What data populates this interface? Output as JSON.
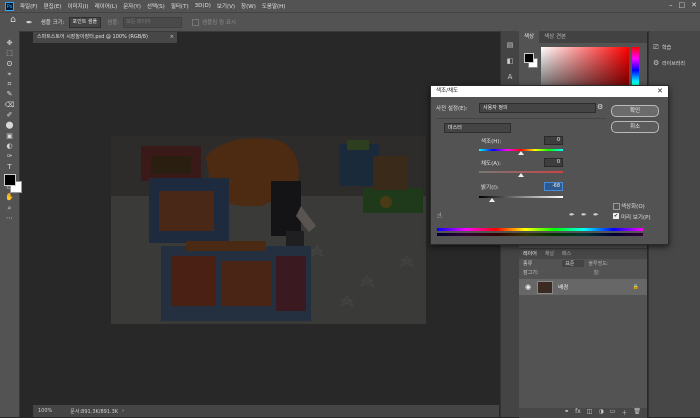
{
  "app": {
    "logo": "Ps"
  },
  "menu": [
    "파일(F)",
    "편집(E)",
    "이미지(I)",
    "레이어(L)",
    "문자(Y)",
    "선택(S)",
    "필터(T)",
    "3D(D)",
    "보기(V)",
    "창(W)",
    "도움말(H)"
  ],
  "window_controls": [
    "–",
    "□",
    "✕"
  ],
  "options": {
    "home_icon": "home-icon",
    "sample_size_label": "샘플 크기:",
    "sample_size_value": "포인트 샘플",
    "sample_label": "샘플:",
    "sample_value": "모든 레이어",
    "sampling_ring": "샘플링 링 표시"
  },
  "tools": [
    "✥",
    "⬚",
    "ʘ",
    "⌖",
    "⌗",
    "✎",
    "⌫",
    "✐",
    "⬤",
    "▣",
    "◐",
    "✑",
    "T",
    "↖",
    "▭",
    "✋",
    "⌕",
    "⋯"
  ],
  "document": {
    "tab_label": "스마트스토어 시장놀이장터.psd @ 100% (RGB/8)",
    "tab_close": "×",
    "status_zoom": "100%",
    "status_doc": "문서:891.3K/891.3K",
    "status_arrow": "›"
  },
  "color_panel": {
    "tabs": [
      "색상",
      "색상 견본"
    ]
  },
  "layers_panel": {
    "tabs": [
      "레이어",
      "채널",
      "패스"
    ],
    "kind_label": "종류",
    "mode_value": "표준",
    "opacity_label": "불투명도:",
    "lock_label": "잠그기:",
    "fill_label": "칠:",
    "layer_name": "배경",
    "lock_icon": "🔒"
  },
  "far_panel": {
    "items": [
      {
        "icon": "⎚",
        "label": "학습"
      },
      {
        "icon": "⚙",
        "label": "라이브러리"
      }
    ]
  },
  "dialog": {
    "title": "색조/채도",
    "close": "✕",
    "preset_label": "사전 설정(E):",
    "preset_value": "사용자 정의",
    "channel_value": "마스터",
    "hue_label": "색조(H):",
    "hue_value": "0",
    "saturation_label": "채도(A):",
    "saturation_value": "0",
    "lightness_label": "밝기(I):",
    "lightness_value": "-68",
    "ok_label": "확인",
    "cancel_label": "취소",
    "colorize_label": "색상화(O)",
    "preview_label": "미리 보기(P)",
    "preview_checked": "✔"
  },
  "colors": {
    "accent": "#31a8ff",
    "panel": "#535353",
    "dark": "#282828"
  }
}
